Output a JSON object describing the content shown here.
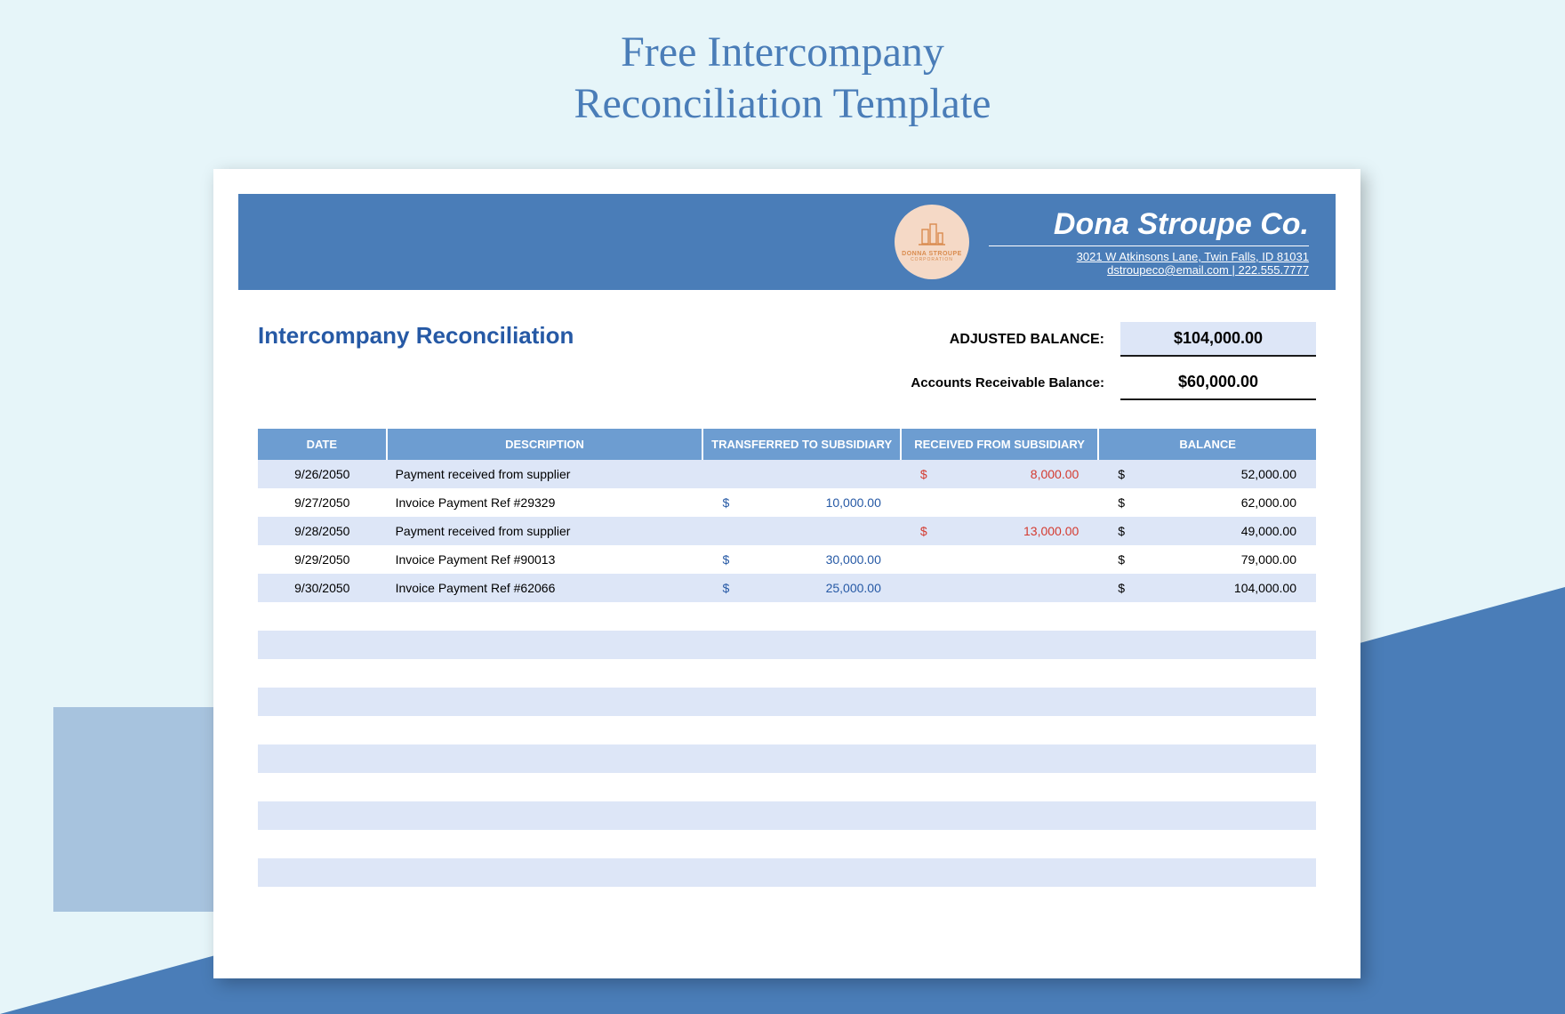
{
  "page": {
    "title_line1": "Free Intercompany",
    "title_line2": "Reconciliation Template"
  },
  "header": {
    "logo_name": "DONNA STROUPE",
    "logo_sub": "CORPORATION",
    "company_name": "Dona Stroupe Co.",
    "address": "3021 W Atkinsons Lane, Twin Falls, ID 81031",
    "contact": "dstroupeco@email.com | 222.555.7777"
  },
  "section": {
    "title": "Intercompany Reconciliation",
    "adjusted_label": "ADJUSTED BALANCE:",
    "adjusted_value": "$104,000.00",
    "ar_label": "Accounts Receivable Balance:",
    "ar_value": "$60,000.00"
  },
  "columns": {
    "date": "DATE",
    "description": "DESCRIPTION",
    "transferred": "TRANSFERRED TO SUBSIDIARY",
    "received": "RECEIVED FROM SUBSIDIARY",
    "balance": "BALANCE"
  },
  "rows": [
    {
      "date": "9/26/2050",
      "description": "Payment received from supplier",
      "transferred": "",
      "received": "8,000.00",
      "balance": "52,000.00"
    },
    {
      "date": "9/27/2050",
      "description": "Invoice Payment Ref #29329",
      "transferred": "10,000.00",
      "received": "",
      "balance": "62,000.00"
    },
    {
      "date": "9/28/2050",
      "description": "Payment received from supplier",
      "transferred": "",
      "received": "13,000.00",
      "balance": "49,000.00"
    },
    {
      "date": "9/29/2050",
      "description": "Invoice Payment Ref #90013",
      "transferred": "30,000.00",
      "received": "",
      "balance": "79,000.00"
    },
    {
      "date": "9/30/2050",
      "description": "Invoice Payment Ref #62066",
      "transferred": "25,000.00",
      "received": "",
      "balance": "104,000.00"
    }
  ],
  "empty_row_count": 10
}
